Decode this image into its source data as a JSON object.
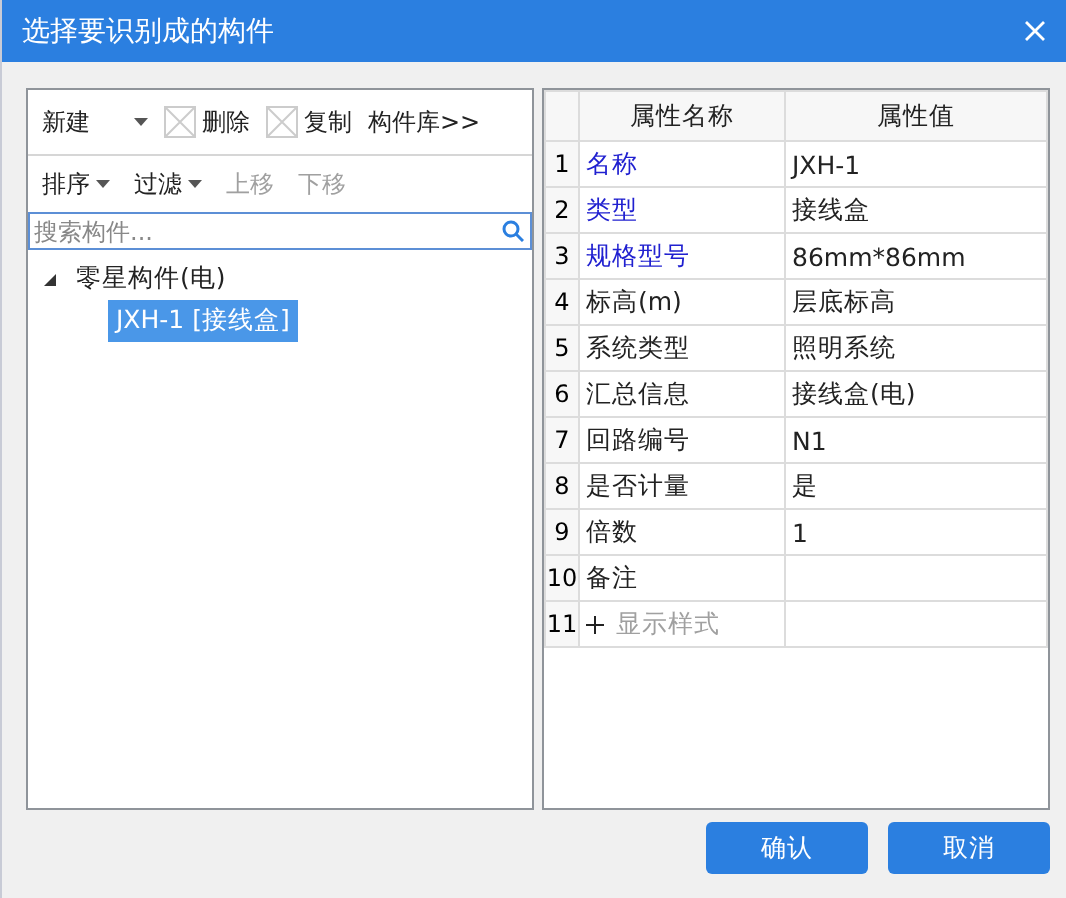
{
  "window": {
    "title": "选择要识别成的构件"
  },
  "toolbar": [
    {
      "label": "新建",
      "kind": "dropdown"
    },
    {
      "label": "删除",
      "kind": "icon"
    },
    {
      "label": "复制",
      "kind": "icon"
    },
    {
      "label": "构件库>>",
      "kind": "plain"
    }
  ],
  "toolbar2": [
    {
      "label": "排序",
      "kind": "dropdown",
      "disabled": false
    },
    {
      "label": "过滤",
      "kind": "dropdown",
      "disabled": false
    },
    {
      "label": "上移",
      "kind": "plain",
      "disabled": true
    },
    {
      "label": "下移",
      "kind": "plain",
      "disabled": true
    }
  ],
  "search": {
    "placeholder": "搜索构件..."
  },
  "tree": [
    {
      "label": "零星构件(电)",
      "expanded": true,
      "selected": false,
      "children": [
        {
          "label": "JXH-1 [接线盒]",
          "selected": true
        }
      ]
    }
  ],
  "table": {
    "columns": [
      "属性名称",
      "属性值"
    ],
    "rows": [
      {
        "index": "1",
        "name": "名称",
        "value": "JXH-1",
        "kind": "property",
        "required": true
      },
      {
        "index": "2",
        "name": "类型",
        "value": "接线盒",
        "kind": "property",
        "required": true
      },
      {
        "index": "3",
        "name": "规格型号",
        "value": "86mm*86mm",
        "kind": "property",
        "required": true
      },
      {
        "index": "4",
        "name": "标高(m)",
        "value": "层底标高",
        "kind": "property",
        "required": false
      },
      {
        "index": "5",
        "name": "系统类型",
        "value": "照明系统",
        "kind": "property",
        "required": false
      },
      {
        "index": "6",
        "name": "汇总信息",
        "value": "接线盒(电)",
        "kind": "property",
        "required": false
      },
      {
        "index": "7",
        "name": "回路编号",
        "value": "N1",
        "kind": "property",
        "required": false
      },
      {
        "index": "8",
        "name": "是否计量",
        "value": "是",
        "kind": "property",
        "required": false
      },
      {
        "index": "9",
        "name": "倍数",
        "value": "1",
        "kind": "property",
        "required": false
      },
      {
        "index": "10",
        "name": "备注",
        "kind": "property",
        "required": false
      },
      {
        "index": "11",
        "name": "显示样式",
        "kind": "group",
        "expanded": false
      }
    ]
  },
  "buttons": [
    "确认",
    "取消"
  ]
}
